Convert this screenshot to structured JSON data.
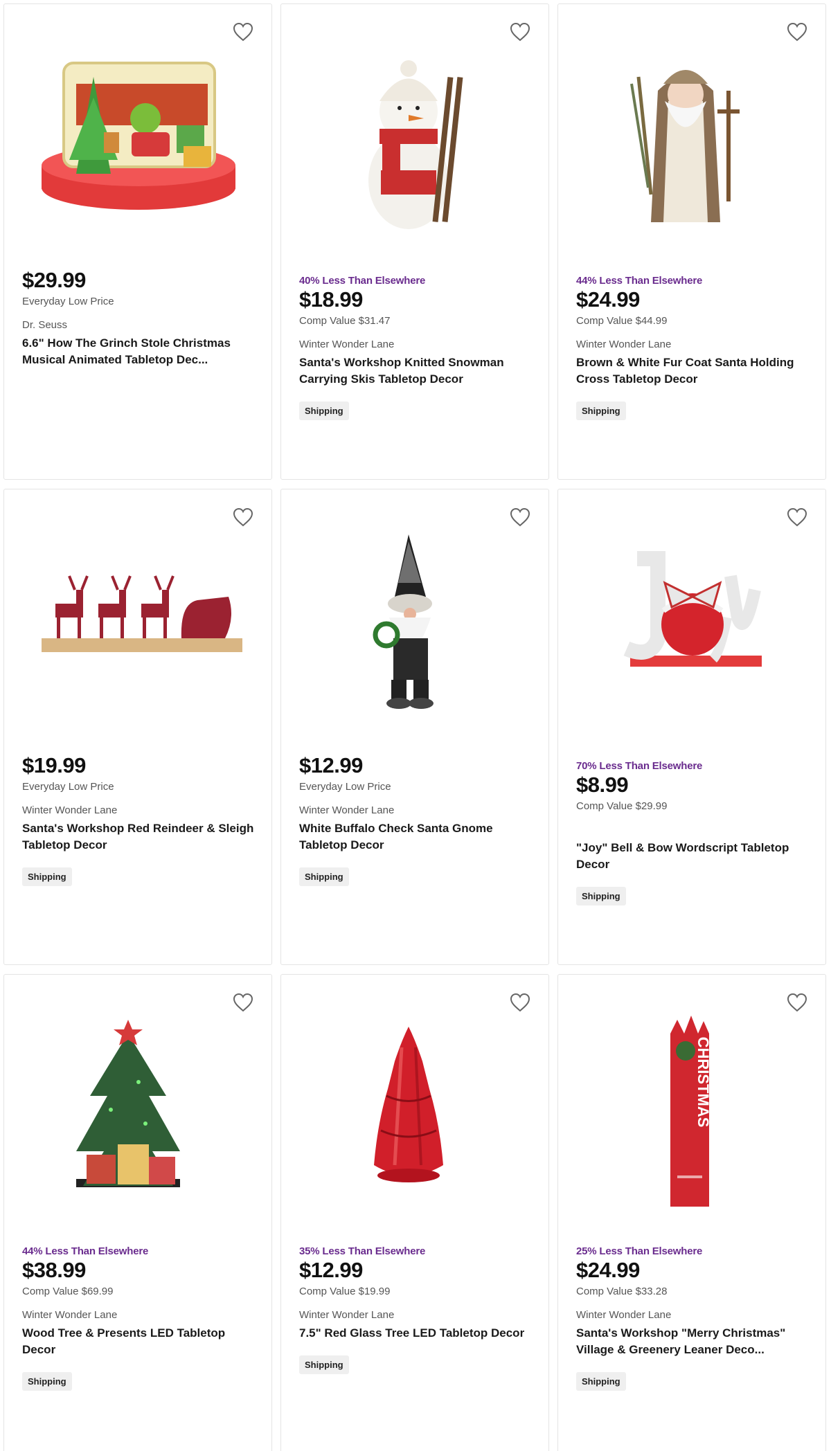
{
  "products": [
    {
      "badge": "",
      "price": "$29.99",
      "price_note": "Everyday Low Price",
      "brand": "Dr. Seuss",
      "title": "6.6\" How The Grinch Stole Christmas Musical Animated Tabletop Dec...",
      "shipping": "",
      "image": "grinch-tabletop-image"
    },
    {
      "badge": "40% Less Than Elsewhere",
      "price": "$18.99",
      "price_note": "Comp Value $31.47",
      "brand": "Winter Wonder Lane",
      "title": "Santa's Workshop Knitted Snowman Carrying Skis Tabletop Decor",
      "shipping": "Shipping",
      "image": "snowman-image"
    },
    {
      "badge": "44% Less Than Elsewhere",
      "price": "$24.99",
      "price_note": "Comp Value $44.99",
      "brand": "Winter Wonder Lane",
      "title": "Brown & White Fur Coat Santa Holding Cross Tabletop Decor",
      "shipping": "Shipping",
      "image": "santa-image"
    },
    {
      "badge": "",
      "price": "$19.99",
      "price_note": "Everyday Low Price",
      "brand": "Winter Wonder Lane",
      "title": "Santa's Workshop Red Reindeer & Sleigh Tabletop Decor",
      "shipping": "Shipping",
      "image": "reindeer-sleigh-image"
    },
    {
      "badge": "",
      "price": "$12.99",
      "price_note": "Everyday Low Price",
      "brand": "Winter Wonder Lane",
      "title": "White Buffalo Check Santa Gnome Tabletop Decor",
      "shipping": "Shipping",
      "image": "gnome-image"
    },
    {
      "badge": "70% Less Than Elsewhere",
      "price": "$8.99",
      "price_note": "Comp Value $29.99",
      "brand": "",
      "title": "\"Joy\" Bell & Bow Wordscript Tabletop Decor",
      "shipping": "Shipping",
      "image": "joy-bell-image"
    },
    {
      "badge": "44% Less Than Elsewhere",
      "price": "$38.99",
      "price_note": "Comp Value $69.99",
      "brand": "Winter Wonder Lane",
      "title": "Wood Tree & Presents LED Tabletop Decor",
      "shipping": "Shipping",
      "image": "wood-tree-image"
    },
    {
      "badge": "35% Less Than Elsewhere",
      "price": "$12.99",
      "price_note": "Comp Value $19.99",
      "brand": "Winter Wonder Lane",
      "title": "7.5\" Red Glass Tree LED Tabletop Decor",
      "shipping": "Shipping",
      "image": "glass-tree-image"
    },
    {
      "badge": "25% Less Than Elsewhere",
      "price": "$24.99",
      "price_note": "Comp Value $33.28",
      "brand": "Winter Wonder Lane",
      "title": "Santa's Workshop \"Merry Christmas\" Village & Greenery Leaner Deco...",
      "shipping": "Shipping",
      "image": "merry-christmas-leaner-image",
      "image_text": "CHRISTMAS"
    }
  ],
  "icons": {
    "favorite": "heart-outline-icon"
  },
  "colors": {
    "badge": "#6a2c8e",
    "price": "#111111",
    "card_border": "#e4e4e4",
    "shipping_bg": "#efefef"
  }
}
